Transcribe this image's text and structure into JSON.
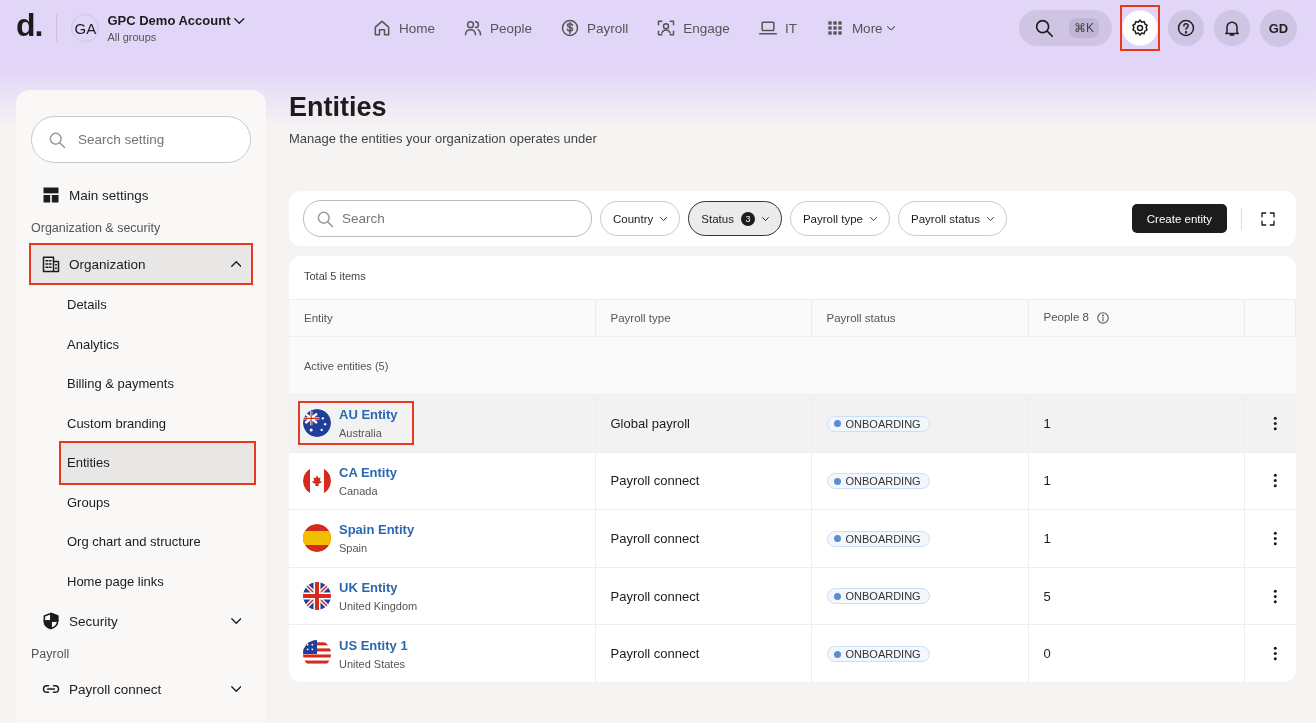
{
  "logo": "d.",
  "account": {
    "initials": "GA",
    "name": "GPC Demo Account",
    "subtitle": "All groups"
  },
  "nav": [
    {
      "label": "Home",
      "dropdown": false
    },
    {
      "label": "People",
      "dropdown": false
    },
    {
      "label": "Payroll",
      "dropdown": false
    },
    {
      "label": "Engage",
      "dropdown": false
    },
    {
      "label": "IT",
      "dropdown": false
    },
    {
      "label": "More",
      "dropdown": true
    }
  ],
  "global_search": {
    "shortcut": "⌘K"
  },
  "top_actions": [
    {
      "kind": "settings",
      "selected": true,
      "highlighted": true
    },
    {
      "kind": "help",
      "selected": false,
      "highlighted": false
    },
    {
      "kind": "bell",
      "selected": false,
      "highlighted": false
    },
    {
      "kind": "avatar",
      "initials": "GD",
      "selected": false,
      "highlighted": false
    }
  ],
  "sidebar": {
    "search": {
      "placeholder": "Search setting"
    },
    "items": [
      {
        "kind": "item",
        "label": "Main settings"
      },
      {
        "kind": "section",
        "label": "Organization & security"
      },
      {
        "kind": "group",
        "label": "Organization",
        "expanded": true,
        "highlighted": true,
        "children": [
          {
            "label": "Details",
            "selected": false,
            "highlighted": false
          },
          {
            "label": "Analytics",
            "selected": false,
            "highlighted": false
          },
          {
            "label": "Billing & payments",
            "selected": false,
            "highlighted": false
          },
          {
            "label": "Custom branding",
            "selected": false,
            "highlighted": false
          },
          {
            "label": "Entities",
            "selected": true,
            "highlighted": true
          },
          {
            "label": "Groups",
            "selected": false,
            "highlighted": false
          },
          {
            "label": "Org chart and structure",
            "selected": false,
            "highlighted": false
          },
          {
            "label": "Home page links",
            "selected": false,
            "highlighted": false
          }
        ]
      },
      {
        "kind": "group",
        "label": "Security",
        "expanded": false,
        "highlighted": false
      },
      {
        "kind": "section",
        "label": "Payroll"
      },
      {
        "kind": "group",
        "label": "Payroll connect",
        "expanded": false,
        "highlighted": false
      }
    ]
  },
  "page": {
    "title": "Entities",
    "subtitle": "Manage the entities your organization operates under"
  },
  "filters": {
    "search": {
      "placeholder": "Search"
    },
    "chips": [
      {
        "label": "Country",
        "selected": false
      },
      {
        "label": "Status",
        "count": "3",
        "selected": true
      },
      {
        "label": "Payroll type",
        "selected": false
      },
      {
        "label": "Payroll status",
        "selected": false
      }
    ],
    "create_button": "Create entity"
  },
  "table": {
    "total": "Total 5 items",
    "columns": [
      {
        "label": "Entity"
      },
      {
        "label": "Payroll type"
      },
      {
        "label": "Payroll status"
      },
      {
        "label": "People 8",
        "info": true
      }
    ],
    "group_label": "Active entities (5)",
    "rows": [
      {
        "name": "AU Entity",
        "country": "Australia",
        "kind": "au",
        "payroll_type": "Global payroll",
        "status": "ONBOARDING",
        "people": "1",
        "hovered": true,
        "highlighted": true
      },
      {
        "name": "CA Entity",
        "country": "Canada",
        "kind": "ca",
        "payroll_type": "Payroll connect",
        "status": "ONBOARDING",
        "people": "1",
        "hovered": false,
        "highlighted": false
      },
      {
        "name": "Spain Entity",
        "country": "Spain",
        "kind": "es",
        "payroll_type": "Payroll connect",
        "status": "ONBOARDING",
        "people": "1",
        "hovered": false,
        "highlighted": false
      },
      {
        "name": "UK Entity",
        "country": "United Kingdom",
        "kind": "gb",
        "payroll_type": "Payroll connect",
        "status": "ONBOARDING",
        "people": "5",
        "hovered": false,
        "highlighted": false
      },
      {
        "name": "US Entity 1",
        "country": "United States",
        "kind": "us",
        "payroll_type": "Payroll connect",
        "status": "ONBOARDING",
        "people": "0",
        "hovered": false,
        "highlighted": false
      }
    ]
  }
}
